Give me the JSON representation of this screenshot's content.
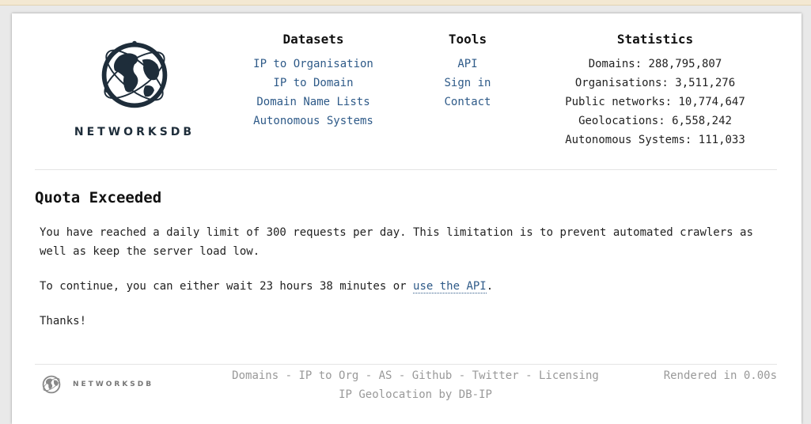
{
  "brand": {
    "name": "NETWORKSDB"
  },
  "nav": {
    "datasets": {
      "heading": "Datasets",
      "items": [
        "IP to Organisation",
        "IP to Domain",
        "Domain Name Lists",
        "Autonomous Systems"
      ]
    },
    "tools": {
      "heading": "Tools",
      "items": [
        "API",
        "Sign in",
        "Contact"
      ]
    },
    "statistics": {
      "heading": "Statistics",
      "items": [
        "Domains: 288,795,807",
        "Organisations: 3,511,276",
        "Public networks: 10,774,647",
        "Geolocations: 6,558,242",
        "Autonomous Systems: 111,033"
      ]
    }
  },
  "main": {
    "title": "Quota Exceeded",
    "paragraph1": "You have reached a daily limit of 300 requests per day. This limitation is to prevent automated crawlers as well as keep the server load low.",
    "paragraph2_prefix": "To continue, you can either wait 23 hours 38 minutes or ",
    "api_link": "use the API",
    "paragraph2_suffix": ".",
    "thanks": "Thanks!"
  },
  "footer": {
    "links": [
      "Domains",
      "IP to Org",
      "AS",
      "Github",
      "Twitter",
      "Licensing"
    ],
    "separator": " - ",
    "geo_link": "IP Geolocation by DB-IP",
    "rendered": "Rendered in 0.00s"
  },
  "colors": {
    "link": "#2e5a88",
    "logo": "#1e2d3a",
    "footer_text": "#999999"
  }
}
